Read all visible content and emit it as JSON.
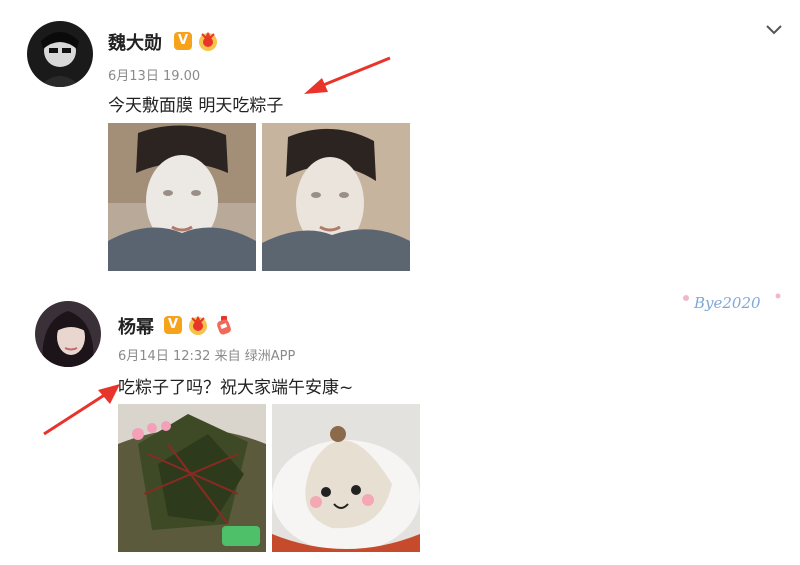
{
  "post1": {
    "author": "魏大勋",
    "timestamp": "6月13日 19.00",
    "text": "今天敷面膜 明天吃粽子",
    "images": [
      "face-mask-selfie-1",
      "face-mask-selfie-2"
    ],
    "menu_icon": "chevron-down-icon"
  },
  "post2": {
    "author": "杨幂",
    "timestamp": "6月14日 12:32",
    "source_prefix": "来自",
    "source": "绿洲APP",
    "text": "吃粽子了吗？祝大家端午安康~",
    "images": [
      "zongzi-on-leaves",
      "peeled-zongzi-with-face"
    ],
    "decorative_sticker": "Bye2020"
  },
  "colors": {
    "verified_badge": "#f7a21b",
    "arrow": "#e8342a",
    "meta_text": "#8a8a8a"
  }
}
